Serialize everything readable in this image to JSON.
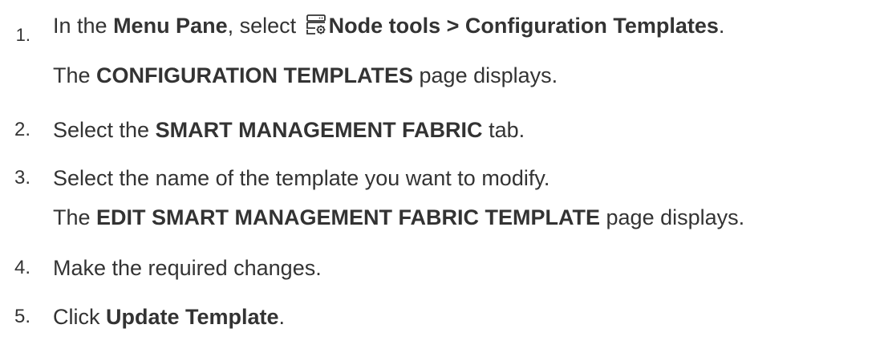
{
  "steps": [
    {
      "number": "1.",
      "parts": {
        "a": "In the ",
        "b_menu_pane": "Menu Pane",
        "c": ", select ",
        "d_node_tools": "Node tools > Configuration Templates",
        "e": "."
      },
      "icon": "node-tools-icon",
      "result_parts": {
        "a_bold": "CONFIGURATION TEMPLATES",
        "prefix": "The ",
        "suffix": " page displays."
      }
    },
    {
      "number": "2.",
      "parts": {
        "a": "Select the ",
        "b_bold": "SMART MANAGEMENT FABRIC",
        "c": " tab."
      }
    },
    {
      "number": "3.",
      "parts": {
        "a": "Select the name of the template you want to modify."
      },
      "result_parts": {
        "prefix": "The ",
        "a_bold": "EDIT SMART MANAGEMENT FABRIC TEMPLATE",
        "suffix": " page displays."
      }
    },
    {
      "number": "4.",
      "parts": {
        "a": "Make the required changes."
      }
    },
    {
      "number": "5.",
      "parts": {
        "a": "Click ",
        "b_bold": "Update Template",
        "c": "."
      }
    }
  ],
  "colors": {
    "text": "#333333",
    "background": "#ffffff"
  }
}
